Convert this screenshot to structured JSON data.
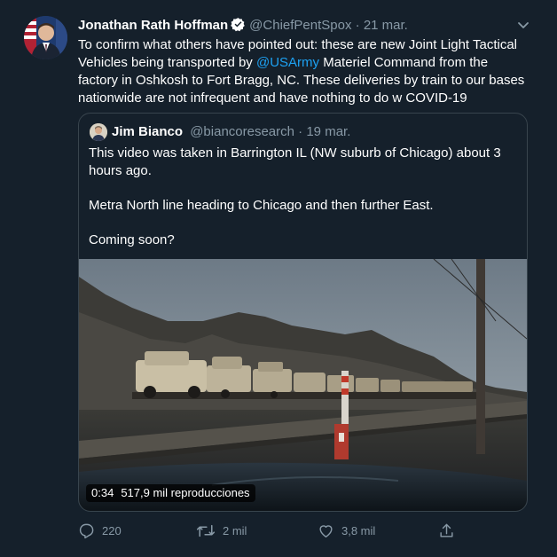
{
  "tweet": {
    "author_name": "Jonathan Rath Hoffman",
    "handle": "@ChiefPentSpox",
    "separator": "·",
    "date": "21 mar.",
    "text_before_mention": "To confirm what others have pointed out: these are new Joint Light Tactical Vehicles being transported by ",
    "mention": "@USArmy",
    "text_after_mention": " Materiel Command from the factory in Oshkosh to Fort Bragg, NC. These deliveries by train to our bases nationwide are not infrequent and have nothing to do w COVID-19"
  },
  "quote": {
    "author_name": "Jim Bianco",
    "handle": "@biancoresearch",
    "separator": "·",
    "date": "19 mar.",
    "paragraphs": [
      "This video was taken in Barrington IL (NW suburb of Chicago) about 3 hours ago.",
      "Metra North line heading to Chicago and then further East.",
      "Coming soon?"
    ],
    "video": {
      "duration": "0:34",
      "views": "517,9 mil reproducciones"
    }
  },
  "actions": {
    "reply_count": "220",
    "retweet_count": "2 mil",
    "like_count": "3,8 mil"
  },
  "icons": [
    "verified-badge-icon",
    "chevron-down-icon",
    "reply-icon",
    "retweet-icon",
    "like-icon",
    "share-icon"
  ],
  "colors": {
    "background": "#15202b",
    "accent": "#1da1f2",
    "muted": "#8899a6",
    "border": "#38444d"
  }
}
